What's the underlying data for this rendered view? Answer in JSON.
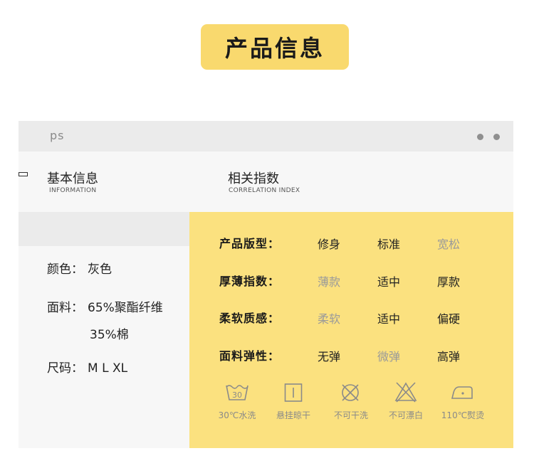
{
  "title": "产品信息",
  "topbar": {
    "label": "ps"
  },
  "sections": {
    "basic": {
      "title": "基本信息",
      "subtitle": "INFORMATION"
    },
    "related": {
      "title": "相关指数",
      "subtitle": "CORRELATION INDEX"
    }
  },
  "basic_info": {
    "color_label": "颜色：",
    "color_value": "灰色",
    "fabric_label": "面料：",
    "fabric_value_1": "65%聚酯纤维",
    "fabric_value_2": "35%棉",
    "size_label": "尺码：",
    "size_value": "M L XL"
  },
  "indices": [
    {
      "label": "产品版型：",
      "options": [
        "修身",
        "标准",
        "宽松"
      ],
      "selected": [
        0,
        1
      ]
    },
    {
      "label": "厚薄指数：",
      "options": [
        "薄款",
        "适中",
        "厚款"
      ],
      "selected": [
        1,
        2
      ]
    },
    {
      "label": "柔软质感：",
      "options": [
        "柔软",
        "适中",
        "偏硬"
      ],
      "selected": [
        1,
        2
      ]
    },
    {
      "label": "面料弹性：",
      "options": [
        "无弹",
        "微弹",
        "高弹"
      ],
      "selected": [
        0,
        2
      ]
    }
  ],
  "care": [
    {
      "icon": "wash-30-icon",
      "label": "30℃水洗",
      "icon_text": "30"
    },
    {
      "icon": "hang-dry-icon",
      "label": "悬挂晾干"
    },
    {
      "icon": "no-dry-clean-icon",
      "label": "不可干洗"
    },
    {
      "icon": "no-bleach-icon",
      "label": "不可漂白"
    },
    {
      "icon": "iron-110-icon",
      "label": "110℃熨烫"
    }
  ],
  "colors": {
    "accent_yellow": "#f9d96e",
    "panel_yellow": "#fbe17f",
    "dim_text": "#9a9a9a"
  }
}
